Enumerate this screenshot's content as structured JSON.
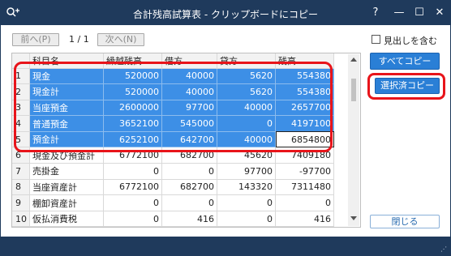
{
  "window": {
    "title": "合計残高試算表 - クリップボードにコピー",
    "controls": {
      "help": "?",
      "minimize": "—",
      "maximize": "☐",
      "close": "✕"
    },
    "app_icon": "search-plus-icon"
  },
  "nav": {
    "prev_label": "前へ(P)",
    "page_info": "1 / 1",
    "next_label": "次へ(N)"
  },
  "options": {
    "include_headings_label": "見出しを含む",
    "include_headings_checked": false
  },
  "buttons": {
    "copy_all": "すべてコピー",
    "copy_selected": "選択済コピー",
    "close": "閉じる"
  },
  "table": {
    "columns": [
      "科目名",
      "繰越残高",
      "借方",
      "貸方",
      "残高"
    ],
    "rows": [
      {
        "num": "1",
        "name": "現金",
        "carry": "520000",
        "debit": "40000",
        "credit": "5620",
        "balance": "554380",
        "selected": true
      },
      {
        "num": "2",
        "name": "現金計",
        "carry": "520000",
        "debit": "40000",
        "credit": "5620",
        "balance": "554380",
        "selected": true
      },
      {
        "num": "3",
        "name": "当座預金",
        "carry": "2600000",
        "debit": "97700",
        "credit": "40000",
        "balance": "2657700",
        "selected": true
      },
      {
        "num": "4",
        "name": "普通預金",
        "carry": "3652100",
        "debit": "545000",
        "credit": "0",
        "balance": "4197100",
        "selected": true
      },
      {
        "num": "5",
        "name": "預金計",
        "carry": "6252100",
        "debit": "642700",
        "credit": "40000",
        "balance": "6854800",
        "selected": true,
        "active_col": "balance"
      },
      {
        "num": "6",
        "name": "現金及び預金計",
        "carry": "6772100",
        "debit": "682700",
        "credit": "45620",
        "balance": "7409180",
        "selected": false
      },
      {
        "num": "7",
        "name": "売掛金",
        "carry": "0",
        "debit": "0",
        "credit": "97700",
        "balance": "-97700",
        "selected": false
      },
      {
        "num": "8",
        "name": "当座資産計",
        "carry": "6772100",
        "debit": "682700",
        "credit": "143320",
        "balance": "7311480",
        "selected": false
      },
      {
        "num": "9",
        "name": "棚卸資産計",
        "carry": "0",
        "debit": "0",
        "credit": "0",
        "balance": "0",
        "selected": false
      },
      {
        "num": "10",
        "name": "仮払消費税",
        "carry": "0",
        "debit": "416",
        "credit": "0",
        "balance": "416",
        "selected": false
      }
    ]
  },
  "colors": {
    "titlebar": "#1f3a5c",
    "selection": "#3d8fe6",
    "primary_button": "#2a7fd6",
    "highlight": "#e8141a"
  }
}
